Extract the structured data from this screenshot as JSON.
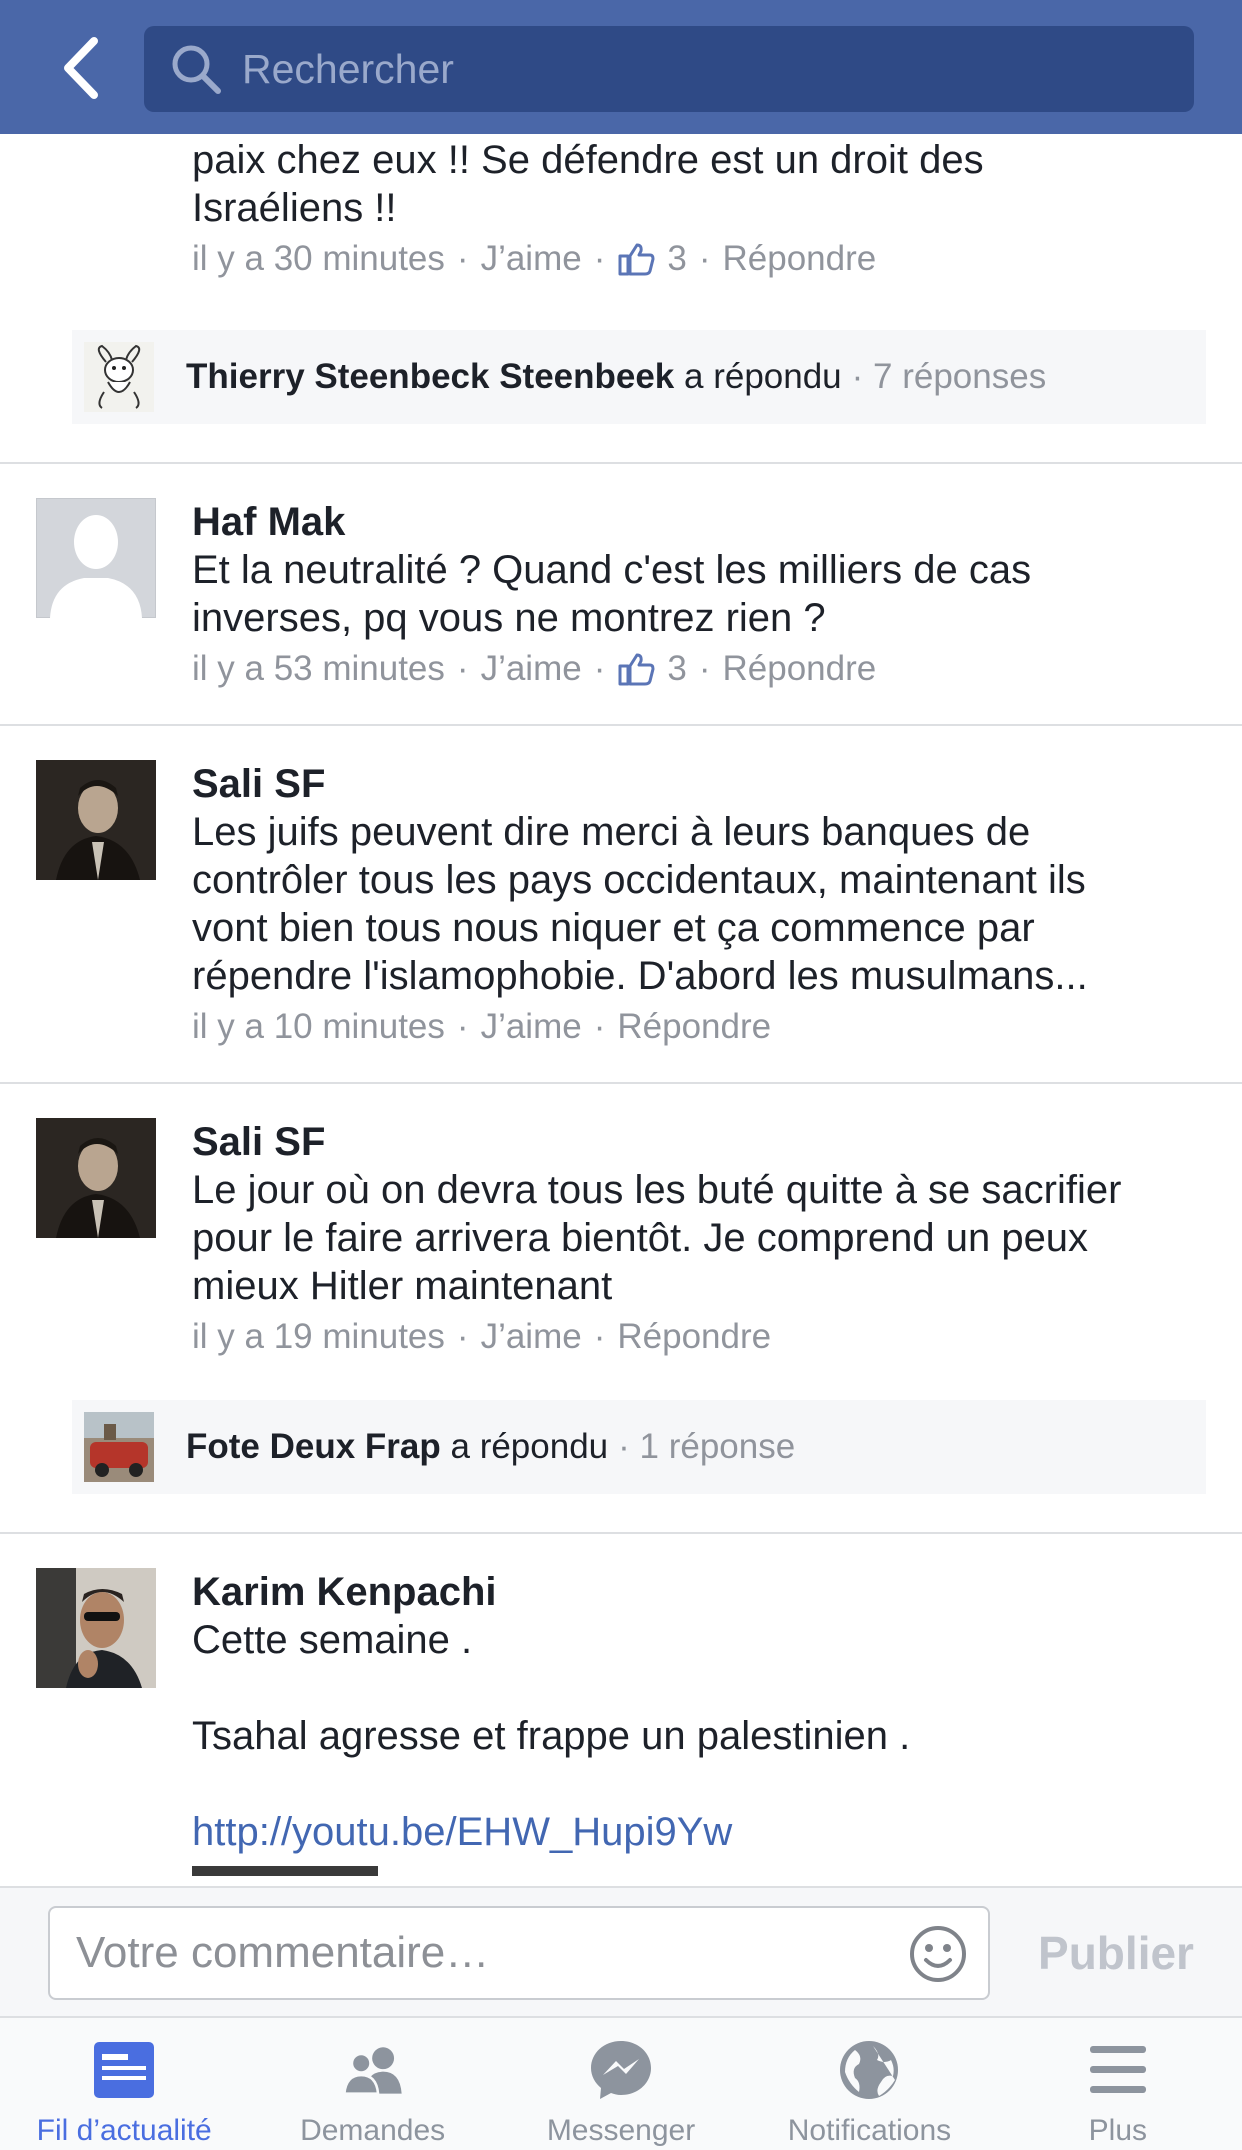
{
  "header": {
    "search_placeholder": "Rechercher"
  },
  "partial_comment": {
    "text": "paix chez eux !! Se défendre est un droit des\nIsraéliens !!",
    "time": "il y a 30 minutes",
    "like": "J’aime",
    "likes": "3",
    "reply": "Répondre"
  },
  "reply_summary_1": {
    "name": "Thierry Steenbeck Steenbeek",
    "action": "a répondu",
    "count": "· 7 réponses"
  },
  "comments": [
    {
      "name": "Haf Mak",
      "text": "Et la neutralité ? Quand c'est les milliers de cas\ninverses, pq vous ne montrez rien ?",
      "time": "il y a 53 minutes",
      "like": "J’aime",
      "likes": "3",
      "reply": "Répondre"
    },
    {
      "name": "Sali SF",
      "text": "Les juifs peuvent dire merci à leurs banques de\ncontrôler tous les pays occidentaux, maintenant ils\nvont bien tous nous niquer et ça commence par\nrépendre l'islamophobie. D'abord les musulmans...",
      "time": "il y a 10 minutes",
      "like": "J’aime",
      "reply": "Répondre"
    },
    {
      "name": "Sali SF",
      "text": "Le jour où on devra tous les buté quitte à se sacrifier\npour le faire arrivera bientôt. Je comprend un peux\nmieux Hitler maintenant",
      "time": "il y a 19 minutes",
      "like": "J’aime",
      "reply": "Répondre"
    },
    {
      "name": "Karim Kenpachi",
      "line1": "Cette semaine .",
      "line2": "Tsahal agresse et frappe un palestinien .",
      "link": "http://youtu.be/EHW_Hupi9Yw"
    }
  ],
  "reply_summary_2": {
    "name": "Fote Deux Frap",
    "action": "a répondu",
    "count": "· 1 réponse"
  },
  "composer": {
    "placeholder": "Votre commentaire…",
    "publish": "Publier"
  },
  "tabs": [
    {
      "label": "Fil d’actualité",
      "icon": "news-feed-icon",
      "active": true
    },
    {
      "label": "Demandes",
      "icon": "friends-icon"
    },
    {
      "label": "Messenger",
      "icon": "messenger-icon"
    },
    {
      "label": "Notifications",
      "icon": "globe-icon"
    },
    {
      "label": "Plus",
      "icon": "menu-icon"
    }
  ],
  "colors": {
    "header": "#4a67a8",
    "search_bg": "#2f4a86",
    "link": "#4267b2",
    "meta": "#90949c",
    "tab_active": "#4a6ee0"
  }
}
